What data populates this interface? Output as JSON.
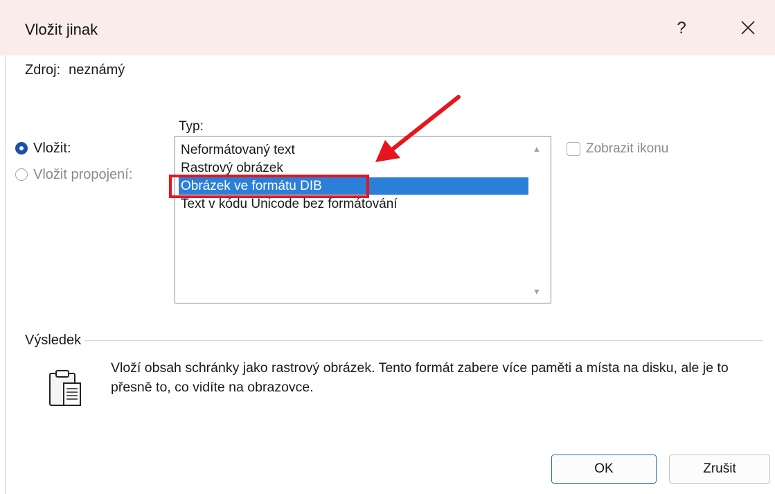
{
  "dialog": {
    "title": "Vložit jinak",
    "help_label": "?",
    "close_icon": "close-icon"
  },
  "source": {
    "label": "Zdroj:",
    "value": "neznámý"
  },
  "paste_options": {
    "type_label": "Typ:",
    "paste_label": "Vložit:",
    "paste_checked": true,
    "paste_link_label": "Vložit propojení:",
    "paste_link_enabled": false
  },
  "type_list": {
    "items": [
      "Neformátovaný text",
      "Rastrový obrázek",
      "Obrázek ve formátu DIB",
      "Text v kódu Unicode bez formátování"
    ],
    "selected": "Obrázek ve formátu DIB"
  },
  "display_icon": {
    "label": "Zobrazit ikonu",
    "checked": false
  },
  "result": {
    "label": "Výsledek",
    "description": "Vloží obsah schránky jako rastrový obrázek. Tento formát zabere více paměti a místa na disku, ale je to přesně to, co vidíte na obrazovce.",
    "icon": "clipboard-icon"
  },
  "buttons": {
    "ok": "OK",
    "cancel": "Zrušit"
  },
  "colors": {
    "title_bar": "#f9ecea",
    "selection": "#2a7fd9",
    "radio_accent": "#1f4fa8",
    "annotation": "#e8141e"
  }
}
